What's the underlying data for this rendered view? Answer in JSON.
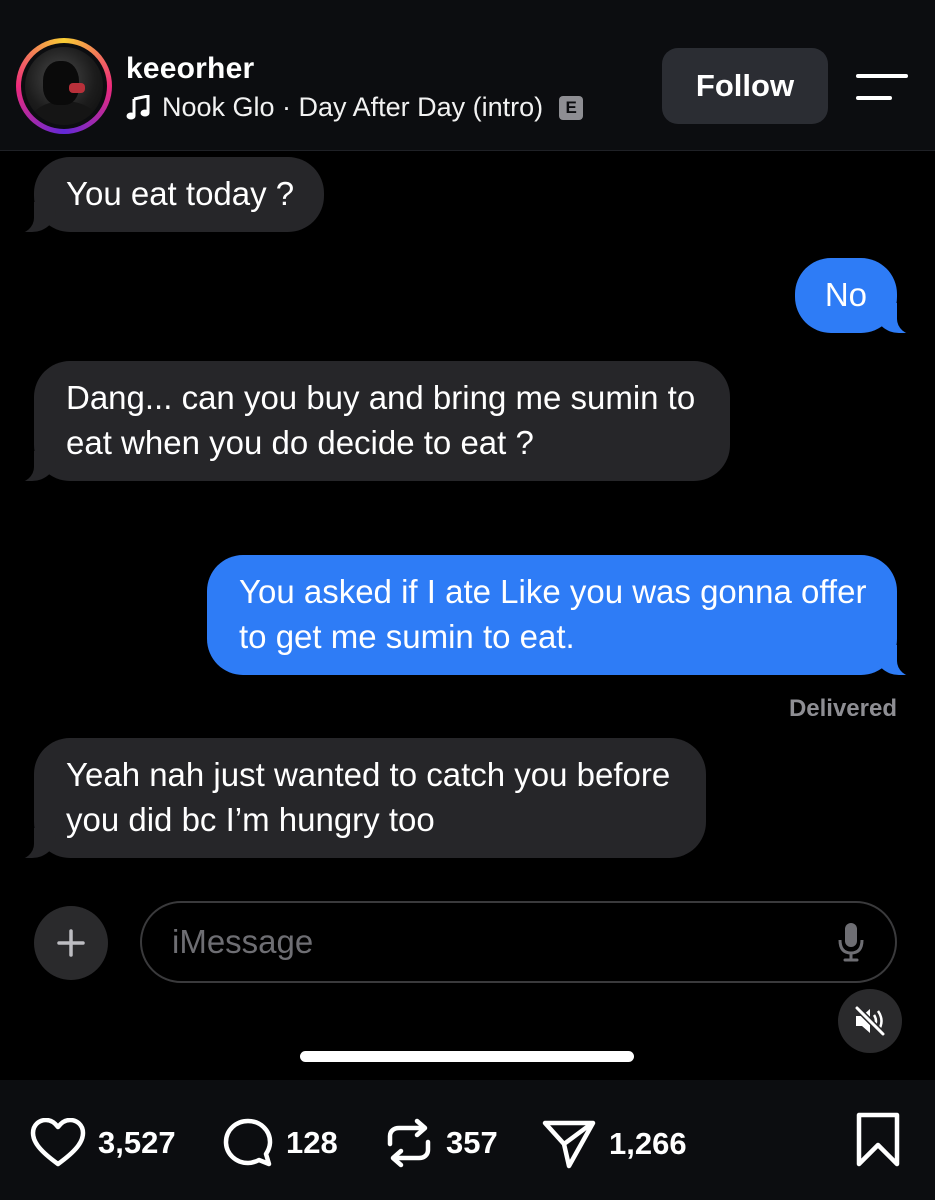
{
  "header": {
    "username": "keeorher",
    "music_label": "Nook Glo · Day After Day (intro)",
    "explicit_badge": "E",
    "follow_label": "Follow"
  },
  "messages": [
    {
      "direction": "incoming",
      "text": "You eat today ?"
    },
    {
      "direction": "outgoing",
      "text": "No"
    },
    {
      "direction": "incoming",
      "text": "Dang... can you buy and bring me sumin to eat when you do decide to eat ?"
    },
    {
      "direction": "outgoing",
      "text": "You asked if I ate Like you was gonna offer to get me sumin to eat."
    },
    {
      "direction": "incoming",
      "text": "Yeah nah just wanted to catch you before you did bc I’m hungry too"
    }
  ],
  "status": {
    "delivered": "Delivered"
  },
  "composer": {
    "placeholder": "iMessage"
  },
  "actions": {
    "likes": "3,527",
    "comments": "128",
    "reposts": "357",
    "shares": "1,266"
  },
  "icons": [
    "music-note-icon",
    "menu-icon",
    "plus-icon",
    "microphone-icon",
    "mute-icon",
    "heart-icon",
    "comment-icon",
    "repost-icon",
    "send-icon",
    "bookmark-icon"
  ],
  "colors": {
    "outgoing_bubble": "#2e7cf6",
    "incoming_bubble": "#262629",
    "background": "#000000"
  }
}
